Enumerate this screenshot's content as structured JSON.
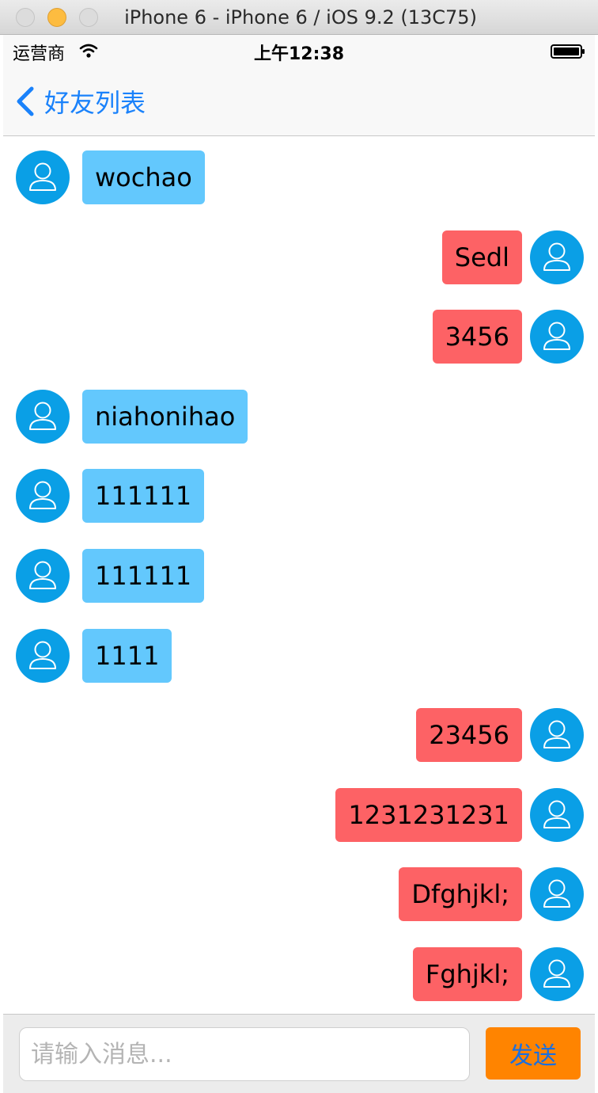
{
  "window": {
    "title": "iPhone 6 - iPhone 6 / iOS 9.2 (13C75)"
  },
  "status_bar": {
    "carrier": "运营商",
    "time": "上午12:38"
  },
  "nav": {
    "back_label": "好友列表"
  },
  "messages": [
    {
      "side": "left",
      "text": "wochao"
    },
    {
      "side": "right",
      "text": "Sedl"
    },
    {
      "side": "right",
      "text": "3456"
    },
    {
      "side": "left",
      "text": "niahonihao"
    },
    {
      "side": "left",
      "text": "111111"
    },
    {
      "side": "left",
      "text": "111111"
    },
    {
      "side": "left",
      "text": "1111"
    },
    {
      "side": "right",
      "text": "23456"
    },
    {
      "side": "right",
      "text": "1231231231"
    },
    {
      "side": "right",
      "text": "Dfghjkl;"
    },
    {
      "side": "right",
      "text": "Fghjkl;"
    }
  ],
  "input_bar": {
    "placeholder": "请输入消息...",
    "value": "",
    "send_label": "发送"
  },
  "colors": {
    "incoming_bubble": "#63c8fd",
    "outgoing_bubble": "#fd6265",
    "avatar": "#0a9fe6",
    "send_button": "#ff8400",
    "send_text": "#1a6fe0",
    "link": "#1a82fb"
  },
  "icons": {
    "avatar": "user-avatar-icon",
    "back": "chevron-left-icon",
    "wifi": "wifi-icon",
    "battery": "battery-icon"
  }
}
